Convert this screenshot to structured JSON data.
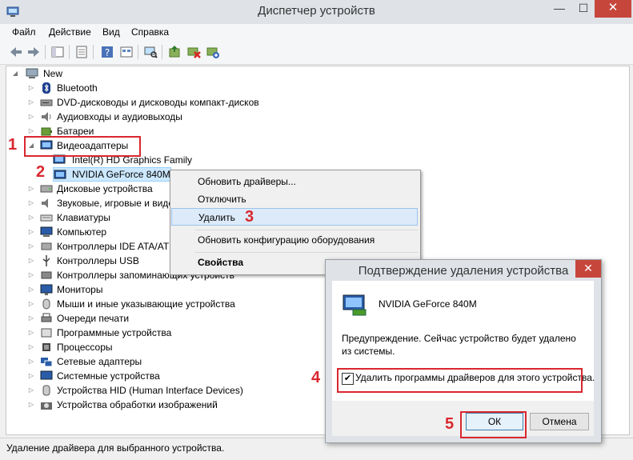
{
  "window": {
    "title": "Диспетчер устройств"
  },
  "title_buttons": {
    "minimize": "—",
    "maximize": "☐",
    "close": "✕"
  },
  "menu": [
    "Файл",
    "Действие",
    "Вид",
    "Справка"
  ],
  "tree": {
    "root": "New",
    "categories": [
      "Bluetooth",
      "DVD-дисководы и дисководы компакт-дисков",
      "Аудиовходы и аудиовыходы",
      "Батареи",
      "Видеоадаптеры",
      "Intel(R) HD Graphics Family",
      "NVIDIA GeForce 840M",
      "Дисковые устройства",
      "Звуковые, игровые и виде",
      "Клавиатуры",
      "Компьютер",
      "Контроллеры IDE ATA/AT",
      "Контроллеры USB",
      "Контроллеры запоминающих устройств",
      "Мониторы",
      "Мыши и иные указывающие устройства",
      "Очереди печати",
      "Программные устройства",
      "Процессоры",
      "Сетевые адаптеры",
      "Системные устройства",
      "Устройства HID (Human Interface Devices)",
      "Устройства обработки изображений"
    ]
  },
  "context_menu": {
    "update": "Обновить драйверы...",
    "disable": "Отключить",
    "uninstall": "Удалить",
    "scan": "Обновить конфигурацию оборудования",
    "properties": "Свойства"
  },
  "dialog": {
    "title": "Подтверждение удаления устройства",
    "device": "NVIDIA GeForce 840M",
    "warning": "Предупреждение. Сейчас устройство будет удалено из системы.",
    "checkbox_label": "Удалить программы драйверов для этого устройства.",
    "checkbox_checked": true,
    "ok": "ОК",
    "cancel": "Отмена",
    "close": "✕"
  },
  "status": "Удаление драйвера для выбранного устройства.",
  "annotations": [
    "1",
    "2",
    "3",
    "4",
    "5"
  ],
  "colors": {
    "annotation": "#d9272e",
    "close_button": "#c7463c",
    "highlight": "#dceaf9"
  }
}
